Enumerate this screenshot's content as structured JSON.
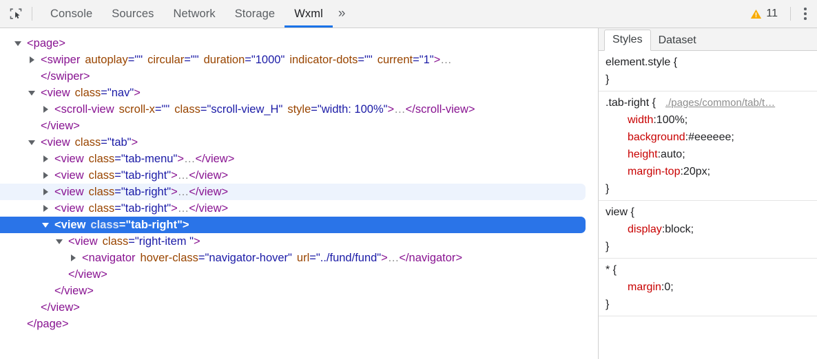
{
  "toolbar": {
    "inspect_icon": "inspect-element-icon",
    "tabs": [
      {
        "label": "Console",
        "active": false
      },
      {
        "label": "Sources",
        "active": false
      },
      {
        "label": "Network",
        "active": false
      },
      {
        "label": "Storage",
        "active": false
      },
      {
        "label": "Wxml",
        "active": true
      }
    ],
    "more_tabs_label": "»",
    "warning_icon": "warning-triangle-icon",
    "warning_count": "11",
    "menu_icon": "kebab-menu-icon",
    "accent_color": "#1a73e8",
    "warning_color": "#f9ab00"
  },
  "tree": {
    "selected_bg": "#2a74e8",
    "hover_bg": "#edf3fd",
    "rows": [
      {
        "indent": 0,
        "twisty": "down",
        "state": "normal",
        "parts": [
          {
            "t": "punct",
            "v": "<"
          },
          {
            "t": "tag",
            "v": "page"
          },
          {
            "t": "punct",
            "v": ">"
          }
        ]
      },
      {
        "indent": 1,
        "twisty": "right",
        "state": "normal",
        "parts": [
          {
            "t": "punct",
            "v": "<"
          },
          {
            "t": "tag",
            "v": "swiper"
          },
          {
            "t": "sp"
          },
          {
            "t": "attr",
            "v": "autoplay"
          },
          {
            "t": "val",
            "v": "=\"\""
          },
          {
            "t": "sp"
          },
          {
            "t": "attr",
            "v": "circular"
          },
          {
            "t": "val",
            "v": "=\"\""
          },
          {
            "t": "sp"
          },
          {
            "t": "attr",
            "v": "duration"
          },
          {
            "t": "val",
            "v": "=\"1000\""
          },
          {
            "t": "sp"
          },
          {
            "t": "attr",
            "v": "indicator-dots"
          },
          {
            "t": "val",
            "v": "=\"\""
          },
          {
            "t": "sp"
          },
          {
            "t": "attr",
            "v": "current"
          },
          {
            "t": "val",
            "v": "=\"1\""
          },
          {
            "t": "punct",
            "v": ">"
          },
          {
            "t": "ellipsis",
            "v": "…"
          }
        ]
      },
      {
        "indent": 1,
        "twisty": "none",
        "state": "normal",
        "parts": [
          {
            "t": "punct",
            "v": "</"
          },
          {
            "t": "tag",
            "v": "swiper"
          },
          {
            "t": "punct",
            "v": ">"
          }
        ]
      },
      {
        "indent": 1,
        "twisty": "down",
        "state": "normal",
        "parts": [
          {
            "t": "punct",
            "v": "<"
          },
          {
            "t": "tag",
            "v": "view"
          },
          {
            "t": "sp"
          },
          {
            "t": "attr",
            "v": "class"
          },
          {
            "t": "val",
            "v": "=\"nav\""
          },
          {
            "t": "punct",
            "v": ">"
          }
        ]
      },
      {
        "indent": 2,
        "twisty": "right",
        "state": "normal",
        "parts": [
          {
            "t": "punct",
            "v": "<"
          },
          {
            "t": "tag",
            "v": "scroll-view"
          },
          {
            "t": "sp"
          },
          {
            "t": "attr",
            "v": "scroll-x"
          },
          {
            "t": "val",
            "v": "=\"\""
          },
          {
            "t": "sp"
          },
          {
            "t": "attr",
            "v": "class"
          },
          {
            "t": "val",
            "v": "=\"scroll-view_H\""
          },
          {
            "t": "sp"
          },
          {
            "t": "attr",
            "v": "style"
          },
          {
            "t": "val",
            "v": "=\"width: 100%\""
          },
          {
            "t": "punct",
            "v": ">"
          },
          {
            "t": "ellipsis",
            "v": "…"
          },
          {
            "t": "punct",
            "v": "</"
          },
          {
            "t": "tag",
            "v": "scroll-view"
          },
          {
            "t": "punct",
            "v": ">"
          }
        ]
      },
      {
        "indent": 1,
        "twisty": "none",
        "state": "normal",
        "parts": [
          {
            "t": "punct",
            "v": "</"
          },
          {
            "t": "tag",
            "v": "view"
          },
          {
            "t": "punct",
            "v": ">"
          }
        ]
      },
      {
        "indent": 1,
        "twisty": "down",
        "state": "normal",
        "parts": [
          {
            "t": "punct",
            "v": "<"
          },
          {
            "t": "tag",
            "v": "view"
          },
          {
            "t": "sp"
          },
          {
            "t": "attr",
            "v": "class"
          },
          {
            "t": "val",
            "v": "=\"tab\""
          },
          {
            "t": "punct",
            "v": ">"
          }
        ]
      },
      {
        "indent": 2,
        "twisty": "right",
        "state": "normal",
        "parts": [
          {
            "t": "punct",
            "v": "<"
          },
          {
            "t": "tag",
            "v": "view"
          },
          {
            "t": "sp"
          },
          {
            "t": "attr",
            "v": "class"
          },
          {
            "t": "val",
            "v": "=\"tab-menu\""
          },
          {
            "t": "punct",
            "v": ">"
          },
          {
            "t": "ellipsis",
            "v": "…"
          },
          {
            "t": "punct",
            "v": "</"
          },
          {
            "t": "tag",
            "v": "view"
          },
          {
            "t": "punct",
            "v": ">"
          }
        ]
      },
      {
        "indent": 2,
        "twisty": "right",
        "state": "normal",
        "parts": [
          {
            "t": "punct",
            "v": "<"
          },
          {
            "t": "tag",
            "v": "view"
          },
          {
            "t": "sp"
          },
          {
            "t": "attr",
            "v": "class"
          },
          {
            "t": "val",
            "v": "=\"tab-right\""
          },
          {
            "t": "punct",
            "v": ">"
          },
          {
            "t": "ellipsis",
            "v": "…"
          },
          {
            "t": "punct",
            "v": "</"
          },
          {
            "t": "tag",
            "v": "view"
          },
          {
            "t": "punct",
            "v": ">"
          }
        ]
      },
      {
        "indent": 2,
        "twisty": "right",
        "state": "hover",
        "parts": [
          {
            "t": "punct",
            "v": "<"
          },
          {
            "t": "tag",
            "v": "view"
          },
          {
            "t": "sp"
          },
          {
            "t": "attr",
            "v": "class"
          },
          {
            "t": "val",
            "v": "=\"tab-right\""
          },
          {
            "t": "punct",
            "v": ">"
          },
          {
            "t": "ellipsis",
            "v": "…"
          },
          {
            "t": "punct",
            "v": "</"
          },
          {
            "t": "tag",
            "v": "view"
          },
          {
            "t": "punct",
            "v": ">"
          }
        ]
      },
      {
        "indent": 2,
        "twisty": "right",
        "state": "normal",
        "parts": [
          {
            "t": "punct",
            "v": "<"
          },
          {
            "t": "tag",
            "v": "view"
          },
          {
            "t": "sp"
          },
          {
            "t": "attr",
            "v": "class"
          },
          {
            "t": "val",
            "v": "=\"tab-right\""
          },
          {
            "t": "punct",
            "v": ">"
          },
          {
            "t": "ellipsis",
            "v": "…"
          },
          {
            "t": "punct",
            "v": "</"
          },
          {
            "t": "tag",
            "v": "view"
          },
          {
            "t": "punct",
            "v": ">"
          }
        ]
      },
      {
        "indent": 2,
        "twisty": "down",
        "state": "selected",
        "parts": [
          {
            "t": "punct",
            "v": "<"
          },
          {
            "t": "tag",
            "v": "view"
          },
          {
            "t": "sp"
          },
          {
            "t": "attr",
            "v": "class"
          },
          {
            "t": "val",
            "v": "=\"tab-right\""
          },
          {
            "t": "punct",
            "v": ">"
          }
        ]
      },
      {
        "indent": 3,
        "twisty": "down",
        "state": "normal",
        "parts": [
          {
            "t": "punct",
            "v": "<"
          },
          {
            "t": "tag",
            "v": "view"
          },
          {
            "t": "sp"
          },
          {
            "t": "attr",
            "v": "class"
          },
          {
            "t": "val",
            "v": "=\"right-item \""
          },
          {
            "t": "punct",
            "v": ">"
          }
        ]
      },
      {
        "indent": 4,
        "twisty": "right",
        "state": "normal",
        "parts": [
          {
            "t": "punct",
            "v": "<"
          },
          {
            "t": "tag",
            "v": "navigator"
          },
          {
            "t": "sp"
          },
          {
            "t": "attr",
            "v": "hover-class"
          },
          {
            "t": "val",
            "v": "=\"navigator-hover\""
          },
          {
            "t": "sp"
          },
          {
            "t": "attr",
            "v": "url"
          },
          {
            "t": "val",
            "v": "=\"../fund/fund\""
          },
          {
            "t": "punct",
            "v": ">"
          },
          {
            "t": "ellipsis",
            "v": "…"
          },
          {
            "t": "punct",
            "v": "</"
          },
          {
            "t": "tag",
            "v": "navigator"
          },
          {
            "t": "punct",
            "v": ">"
          }
        ]
      },
      {
        "indent": 3,
        "twisty": "none",
        "state": "normal",
        "parts": [
          {
            "t": "punct",
            "v": "</"
          },
          {
            "t": "tag",
            "v": "view"
          },
          {
            "t": "punct",
            "v": ">"
          }
        ]
      },
      {
        "indent": 2,
        "twisty": "none",
        "state": "normal",
        "parts": [
          {
            "t": "punct",
            "v": "</"
          },
          {
            "t": "tag",
            "v": "view"
          },
          {
            "t": "punct",
            "v": ">"
          }
        ]
      },
      {
        "indent": 1,
        "twisty": "none",
        "state": "normal",
        "parts": [
          {
            "t": "punct",
            "v": "</"
          },
          {
            "t": "tag",
            "v": "view"
          },
          {
            "t": "punct",
            "v": ">"
          }
        ]
      },
      {
        "indent": 0,
        "twisty": "none",
        "state": "normal",
        "parts": [
          {
            "t": "punct",
            "v": "</"
          },
          {
            "t": "tag",
            "v": "page"
          },
          {
            "t": "punct",
            "v": ">"
          }
        ]
      }
    ]
  },
  "styles_panel": {
    "tabs": [
      {
        "label": "Styles",
        "active": true
      },
      {
        "label": "Dataset",
        "active": false
      }
    ],
    "rules": [
      {
        "selector": "element.style {",
        "source": "",
        "declarations": [],
        "close": "}"
      },
      {
        "selector": ".tab-right {",
        "source": "./pages/common/tab/t…",
        "declarations": [
          {
            "prop": "width",
            "value": "100%"
          },
          {
            "prop": "background",
            "value": "#eeeeee"
          },
          {
            "prop": "height",
            "value": "auto"
          },
          {
            "prop": "margin-top",
            "value": "20px"
          }
        ],
        "close": "}"
      },
      {
        "selector": "view {",
        "source": "",
        "declarations": [
          {
            "prop": "display",
            "value": "block"
          }
        ],
        "close": "}"
      },
      {
        "selector": "* {",
        "source": "",
        "declarations": [
          {
            "prop": "margin",
            "value": "0"
          }
        ],
        "close": "}"
      }
    ]
  }
}
